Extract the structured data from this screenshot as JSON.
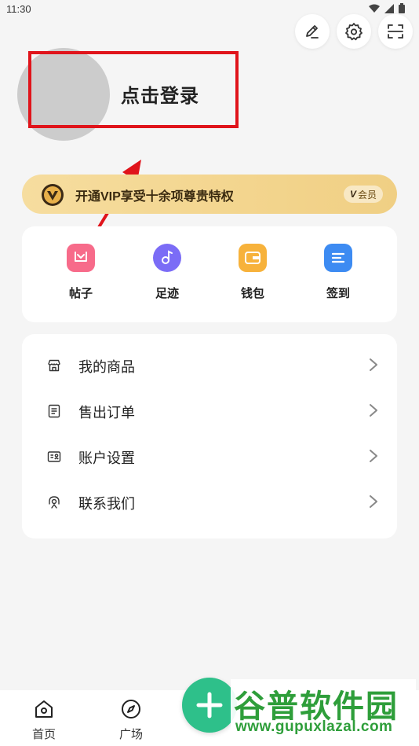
{
  "status_bar": {
    "time": "11:30"
  },
  "profile": {
    "login_text": "点击登录"
  },
  "vip": {
    "text": "开通VIP享受十余项尊贵特权",
    "tag": "会员",
    "tag_mark": "V"
  },
  "quick_actions": [
    {
      "label": "帖子",
      "icon": "post-icon",
      "color": "#f76b8a"
    },
    {
      "label": "足迹",
      "icon": "footprint-icon",
      "color": "#7b6cf6"
    },
    {
      "label": "钱包",
      "icon": "wallet-icon",
      "color": "#f7b23b"
    },
    {
      "label": "签到",
      "icon": "checkin-icon",
      "color": "#3d8bf2"
    }
  ],
  "menu": [
    {
      "label": "我的商品",
      "icon": "store-icon"
    },
    {
      "label": "售出订单",
      "icon": "order-icon"
    },
    {
      "label": "账户设置",
      "icon": "account-card-icon"
    },
    {
      "label": "联系我们",
      "icon": "headset-icon"
    }
  ],
  "tabs": [
    {
      "label": "首页",
      "icon": "home-icon"
    },
    {
      "label": "广场",
      "icon": "compass-icon"
    }
  ],
  "watermark": {
    "title": "谷普软件园",
    "url": "www.gupuxlazal.com"
  },
  "colors": {
    "highlight": "#e0141b",
    "fab": "#2ec08a",
    "vip_gold": "#f3d58e",
    "watermark": "#2e9e3a"
  }
}
